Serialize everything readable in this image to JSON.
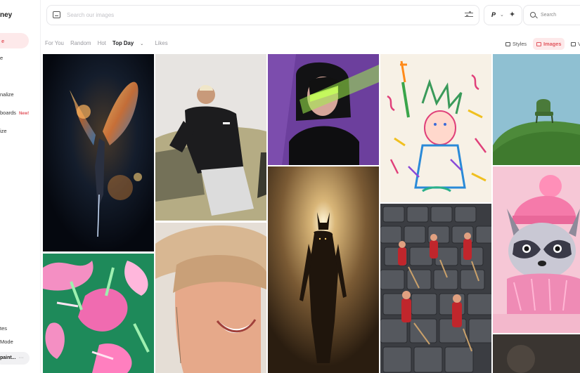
{
  "sidebar": {
    "logo": "ney",
    "items": [
      {
        "label": "e",
        "active": true
      },
      {
        "label": "e"
      },
      {
        "label": "nalize"
      },
      {
        "label": "boards",
        "badge": "New!"
      },
      {
        "label": "ize"
      }
    ],
    "bottom": [
      {
        "label": "tes"
      },
      {
        "label": "Mode"
      }
    ],
    "user_pill": "paint...",
    "user_pill_menu": "···"
  },
  "search": {
    "placeholder": "Search our images",
    "model_label": "P",
    "right_label": "Search"
  },
  "tabs": [
    {
      "label": "For You"
    },
    {
      "label": "Random"
    },
    {
      "label": "Hot"
    },
    {
      "label": "Top Day",
      "active": true,
      "caret": "⌄"
    },
    {
      "label": "Likes"
    }
  ],
  "view_toggle": {
    "styles": "Styles",
    "images": "Images",
    "more": "V"
  },
  "gallery": [
    {
      "name": "fiery-winged-angel"
    },
    {
      "name": "man-leaning-on-car"
    },
    {
      "name": "woman-neon-light"
    },
    {
      "name": "statue-of-liberty-doodle"
    },
    {
      "name": "chair-on-green-hill"
    },
    {
      "name": "smiling-woman-hat"
    },
    {
      "name": "anubis-silhouette"
    },
    {
      "name": "tiny-workers-keyboard"
    },
    {
      "name": "raccoon-pink-hat"
    },
    {
      "name": "pink-green-tropical-pattern"
    },
    {
      "name": "dark-partial-tile"
    }
  ],
  "colors": {
    "accent": "#e2565e",
    "accent_bg": "#fde9ea"
  }
}
